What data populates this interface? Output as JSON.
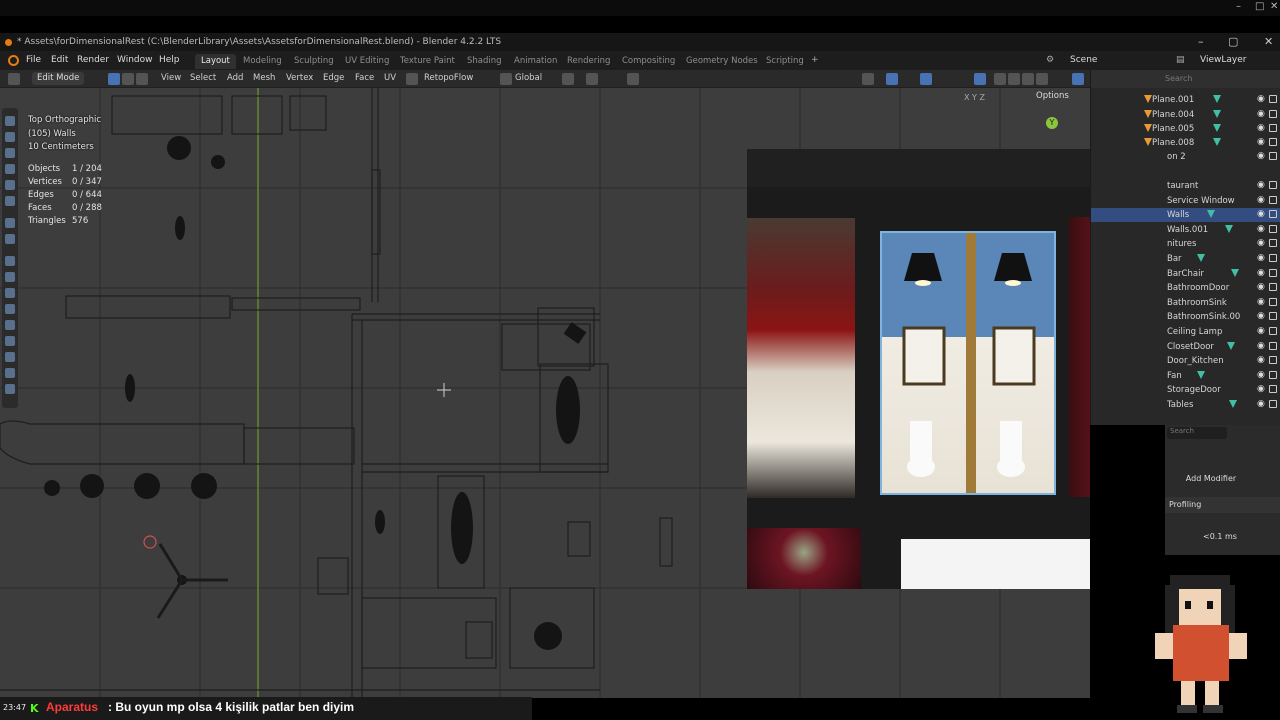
{
  "os": {
    "minimize": "–",
    "maximize": "□",
    "close": "✕"
  },
  "window": {
    "title": "* Assets\\forDimensionalRest (C:\\BlenderLibrary\\Assets\\AssetsforDimensionalRest.blend) - Blender 4.2.2 LTS",
    "minimize": "–",
    "maximize": "▢",
    "close": "✕"
  },
  "menu": [
    "File",
    "Edit",
    "Render",
    "Window",
    "Help"
  ],
  "workspaces": [
    {
      "label": "Layout",
      "active": true
    },
    {
      "label": "Modeling"
    },
    {
      "label": "Sculpting"
    },
    {
      "label": "UV Editing"
    },
    {
      "label": "Texture Paint"
    },
    {
      "label": "Shading"
    },
    {
      "label": "Animation"
    },
    {
      "label": "Rendering"
    },
    {
      "label": "Compositing"
    },
    {
      "label": "Geometry Nodes"
    },
    {
      "label": "Scripting"
    }
  ],
  "add_workspace": "+",
  "scene": {
    "label": "Scene",
    "view_layer": "ViewLayer"
  },
  "header": {
    "mode": "Edit Mode",
    "menus": [
      "View",
      "Select",
      "Add",
      "Mesh",
      "Vertex",
      "Edge",
      "Face",
      "UV"
    ],
    "addon": "RetopoFlow",
    "orientation": "Global"
  },
  "viewport": {
    "view_name": "Top Orthographic",
    "object_name": "(105) Walls",
    "scale": "10 Centimeters",
    "stats": [
      {
        "label": "Objects",
        "value": "1 / 204"
      },
      {
        "label": "Vertices",
        "value": "0 / 347"
      },
      {
        "label": "Edges",
        "value": "0 / 644"
      },
      {
        "label": "Faces",
        "value": "0 / 288"
      },
      {
        "label": "Triangles",
        "value": "576"
      }
    ],
    "options": "Options",
    "gizmo_y": "Y",
    "view_axes": "X Y Z"
  },
  "outliner": {
    "search_placeholder": "Search",
    "rows": [
      {
        "label": "Plane.001",
        "type": "mesh"
      },
      {
        "label": "Plane.004",
        "type": "mesh"
      },
      {
        "label": "Plane.005",
        "type": "mesh"
      },
      {
        "label": "Plane.008",
        "type": "mesh"
      },
      {
        "label": "on 2",
        "type": "collection"
      },
      {
        "label": "taurant",
        "type": "collection"
      },
      {
        "label": "Service Window",
        "type": "mesh"
      },
      {
        "label": "Walls",
        "type": "mesh",
        "selected": true
      },
      {
        "label": "Walls.001",
        "type": "mesh"
      },
      {
        "label": "nitures",
        "type": "collection"
      },
      {
        "label": "Bar",
        "type": "mesh"
      },
      {
        "label": "BarChair",
        "type": "mesh"
      },
      {
        "label": "BathroomDoor",
        "type": "mesh"
      },
      {
        "label": "BathroomSink",
        "type": "mesh"
      },
      {
        "label": "BathroomSink.00",
        "type": "mesh"
      },
      {
        "label": "Ceiling Lamp",
        "type": "mesh"
      },
      {
        "label": "ClosetDoor",
        "type": "mesh"
      },
      {
        "label": "Door_Kitchen",
        "type": "mesh"
      },
      {
        "label": "Fan",
        "type": "mesh"
      },
      {
        "label": "StorageDoor",
        "type": "mesh"
      },
      {
        "label": "Tables",
        "type": "mesh"
      }
    ]
  },
  "properties": {
    "search_placeholder": "Search",
    "add_modifier": "Add Modifier",
    "profiling": "Profiling",
    "time": "<0.1 ms"
  },
  "chat": {
    "time": "23:47",
    "badge": "K",
    "user": "Aparatus",
    "message": ": Bu oyun mp olsa 4 kişilik patlar ben diyim"
  },
  "colors": {
    "accent": "#e87d0d",
    "selection": "#334d80",
    "grid_y_axis": "#8cc63f",
    "chat_user": "#ff3b3b",
    "kick_green": "#53fc18"
  }
}
